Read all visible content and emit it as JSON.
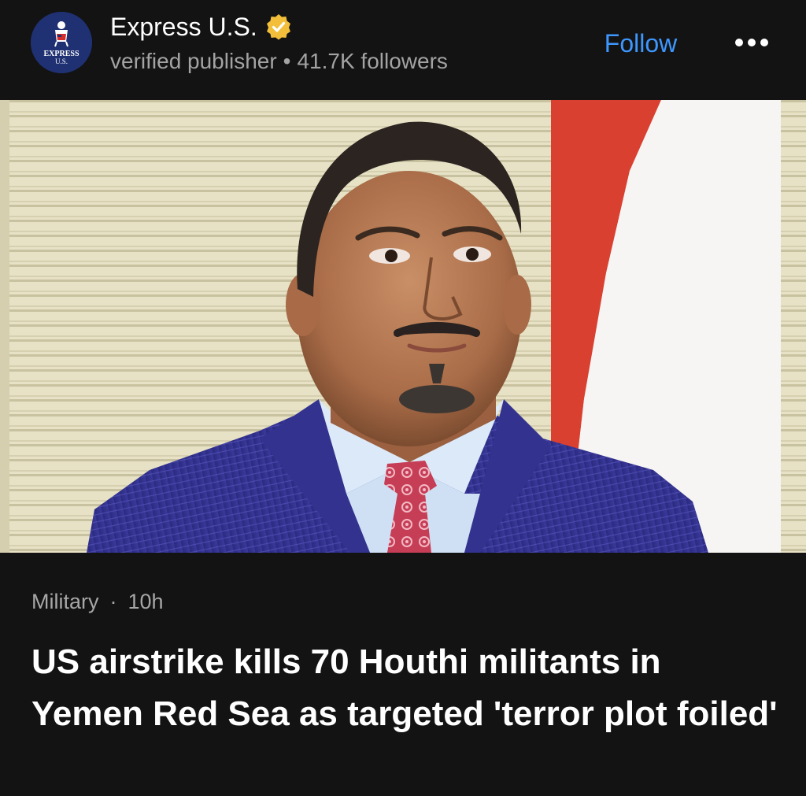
{
  "publisher": {
    "name": "Express U.S.",
    "logo_text_line1": "EXPRESS",
    "logo_text_line2": "U.S.",
    "badge_icon": "verified-check-icon",
    "status": "verified publisher",
    "followers": "41.7K followers",
    "follow_label": "Follow",
    "more_icon": "more-horizontal-icon"
  },
  "article": {
    "category": "Military",
    "separator": "·",
    "age": "10h",
    "headline": "US airstrike kills 70 Houthi militants in Yemen Red Sea as targeted 'terror plot foiled'"
  },
  "colors": {
    "background": "#131313",
    "accent": "#3e97ff",
    "meta_text": "#a3a3a3",
    "badge": "#f3bf3a",
    "logo": "#1f3172"
  }
}
